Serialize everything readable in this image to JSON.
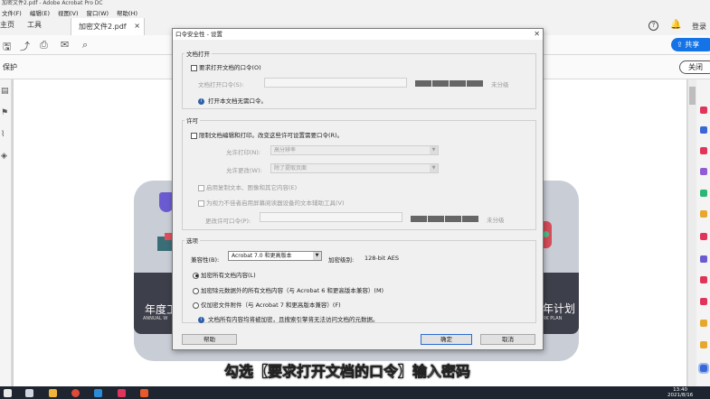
{
  "window": {
    "title": "加密文件2.pdf - Adobe Acrobat Pro DC"
  },
  "menu": [
    "文件(F)",
    "编辑(E)",
    "视图(V)",
    "窗口(W)",
    "帮助(H)"
  ],
  "tabs": {
    "home": "主页",
    "tools": "工具",
    "doc": "加密文件2.pdf"
  },
  "header": {
    "login": "登录",
    "share": "共享"
  },
  "protect": {
    "label": "保护",
    "close": "关闭"
  },
  "background": {
    "title_left": "年度工",
    "sub_left": "ANNUAL W",
    "title_right": "年计划",
    "sub_right": "ORK PLAN"
  },
  "dialog": {
    "title": "口令安全性 - 设置",
    "open_group": {
      "label": "文档打开",
      "require_checkbox": "要求打开文档的口令(O)",
      "password_label": "文档打开口令(S):",
      "strength": "未分级",
      "note": "打开本文档无需口令。"
    },
    "perm_group": {
      "label": "许可",
      "restrict_checkbox": "限制文档编辑和打印。改变这些许可设置需要口令(R)。",
      "printing_label": "允许打印(N):",
      "printing_value": "高分辨率",
      "changes_label": "允许更改(W):",
      "changes_value": "除了提取页面",
      "enable_copy": "启用复制文本、图像和其它内容(E)",
      "enable_access": "为视力不佳者启用屏幕阅读器设备的文本辅助工具(V)",
      "perm_password_label": "更改许可口令(P):",
      "strength": "未分级"
    },
    "options_group": {
      "label": "选项",
      "compat_label": "兼容性(B):",
      "compat_value": "Acrobat 7.0 和更高版本",
      "encrypt_level_label": "加密级别:",
      "encrypt_level_value": "128-bit AES",
      "radio_all": "加密所有文档内容(L)",
      "radio_except_meta": "加密除元数据外的所有文档内容（与 Acrobat 6 和更高版本兼容）(M)",
      "radio_attachments": "仅加密文件附件（与 Acrobat 7 和更高版本兼容）(F)",
      "note": "文档所有内容均将被加密，且搜索引擎将无法访问文档的元数据。"
    },
    "buttons": {
      "help": "帮助",
      "ok": "确定",
      "cancel": "取消"
    }
  },
  "caption": "勾选【要求打开文档的口令】输入密码",
  "taskbar": {
    "time": "13:40",
    "date": "2021/8/16"
  },
  "colors": {
    "accent": "#1473e6",
    "dialog_bg": "#f0f0f0",
    "taskbar": "#1e2530"
  }
}
